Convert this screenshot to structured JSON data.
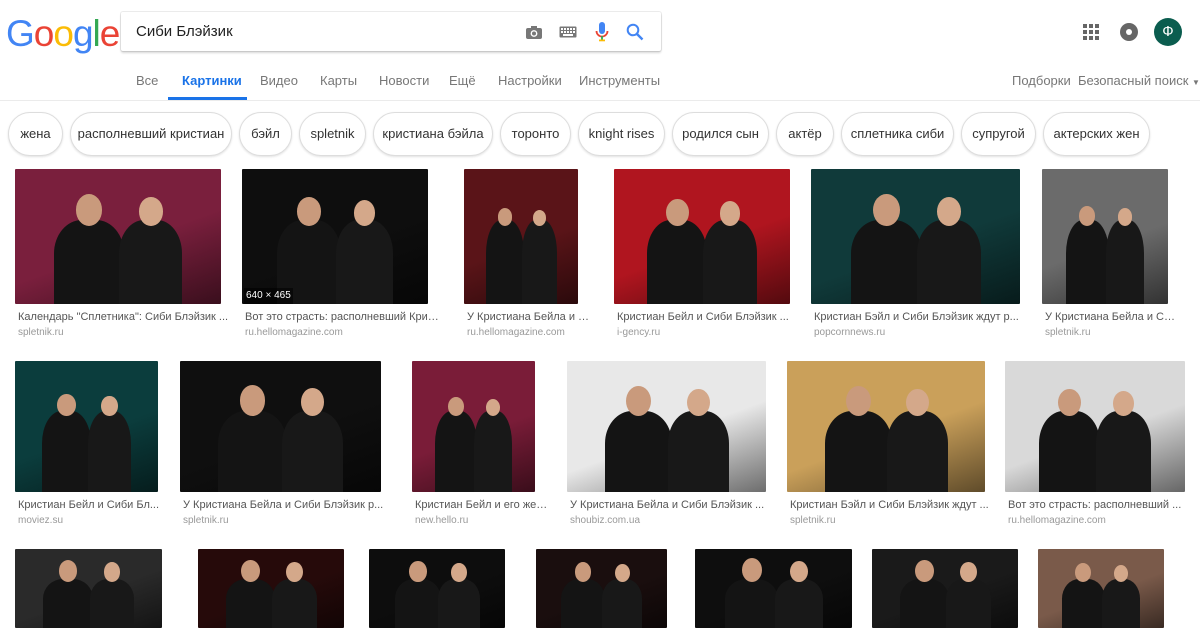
{
  "logo": [
    "G",
    "o",
    "o",
    "g",
    "l",
    "e"
  ],
  "search": {
    "query": "Сиби Блэйзик"
  },
  "user": {
    "avatar_letter": "Ф"
  },
  "tabs": [
    {
      "label": "Все"
    },
    {
      "label": "Картинки"
    },
    {
      "label": "Видео"
    },
    {
      "label": "Карты"
    },
    {
      "label": "Новости"
    },
    {
      "label": "Ещё"
    },
    {
      "label": "Настройки"
    },
    {
      "label": "Инструменты"
    }
  ],
  "right_tabs": {
    "collections": "Подборки",
    "safe_search": "Безопасный поиск"
  },
  "chips": [
    "жена",
    "располневший кристиан",
    "бэйл",
    "spletnik",
    "кристиана бэйла",
    "торонто",
    "knight rises",
    "родился сын",
    "актёр",
    "сплетника сиби",
    "супругой",
    "актерских жен"
  ],
  "results": [
    {
      "caption": "Календарь \"Сплетника\": Сиби Блэйзик ...",
      "source": "spletnik.ru"
    },
    {
      "caption": "Вот это страсть: располневший Кристиан ...",
      "source": "ru.hellomagazine.com",
      "dims": "640 × 465"
    },
    {
      "caption": "У Кристиана Бейла и Сиби ...",
      "source": "ru.hellomagazine.com"
    },
    {
      "caption": "Кристиан Бейл и Сиби Блэйзик ...",
      "source": "i-gency.ru"
    },
    {
      "caption": "Кристиан Бэйл и Сиби Блэйзик ждут р...",
      "source": "popcornnews.ru"
    },
    {
      "caption": "У Кристиана Бейла и Сиб...",
      "source": "spletnik.ru"
    },
    {
      "caption": "Кристиан Бейл и Сиби Бл...",
      "source": "moviez.su"
    },
    {
      "caption": "У Кристиана Бейла и Сиби Блэйзик р...",
      "source": "spletnik.ru"
    },
    {
      "caption": "Кристиан Бейл и его жен...",
      "source": "new.hello.ru"
    },
    {
      "caption": "У Кристиана Бейла и Сиби Блэйзик ...",
      "source": "shoubiz.com.ua"
    },
    {
      "caption": "Кристиан Бэйл и Сиби Блэйзик ждут ...",
      "source": "spletnik.ru"
    },
    {
      "caption": "Вот это страсть: располневший ...",
      "source": "ru.hellomagazine.com"
    },
    {
      "caption": "",
      "source": ""
    },
    {
      "caption": "",
      "source": ""
    },
    {
      "caption": "",
      "source": ""
    },
    {
      "caption": "",
      "source": ""
    },
    {
      "caption": "",
      "source": ""
    },
    {
      "caption": "",
      "source": ""
    },
    {
      "caption": "",
      "source": ""
    }
  ],
  "colors": {
    "accent": "#1a73e8",
    "avatar": "#0b5d4f"
  }
}
